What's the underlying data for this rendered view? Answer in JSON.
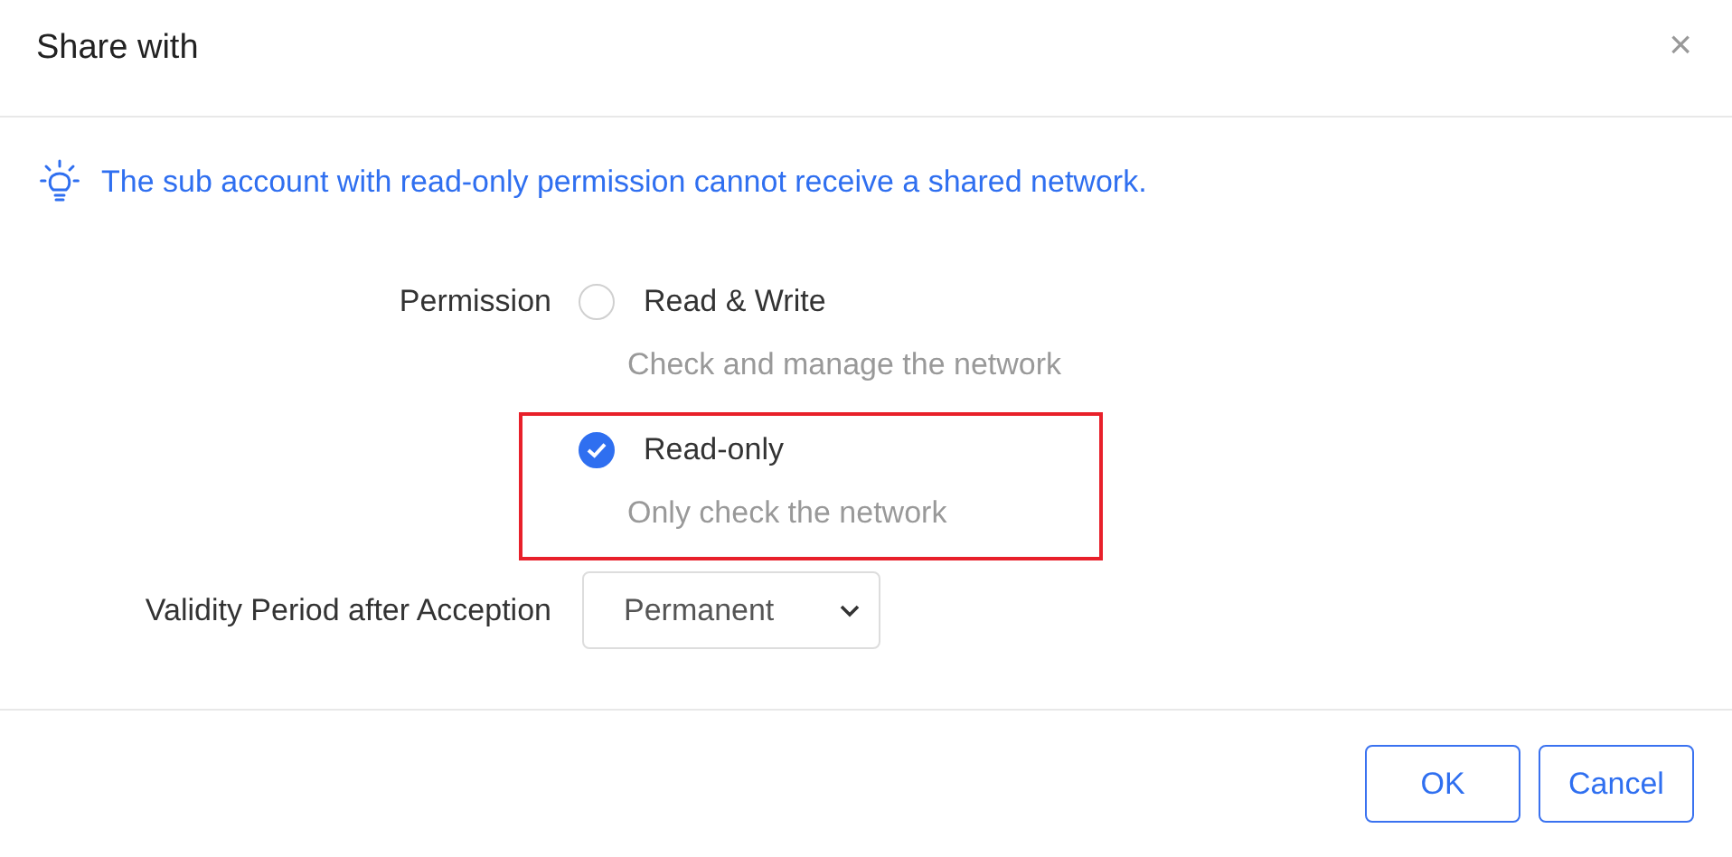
{
  "dialog": {
    "title": "Share with",
    "close": "×"
  },
  "notice": "The sub account with read-only permission cannot receive a shared network.",
  "permission": {
    "label": "Permission",
    "options": [
      {
        "label": "Read & Write",
        "description": "Check and manage the network",
        "selected": false,
        "highlighted": false
      },
      {
        "label": "Read-only",
        "description": "Only check the network",
        "selected": true,
        "highlighted": true
      }
    ]
  },
  "validity": {
    "label": "Validity Period after Acception",
    "value": "Permanent"
  },
  "buttons": [
    "OK",
    "Cancel"
  ]
}
